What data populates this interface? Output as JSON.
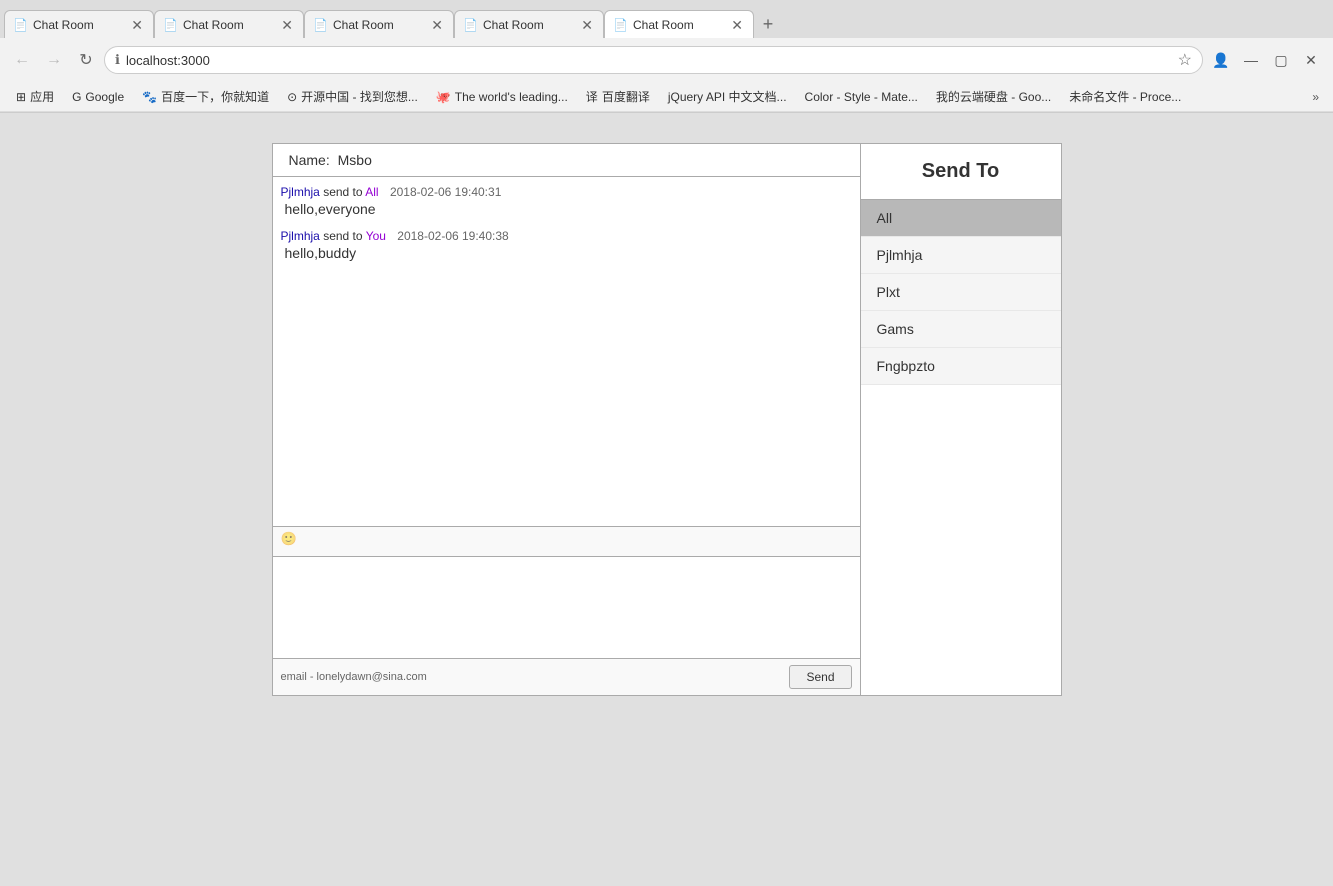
{
  "browser": {
    "tabs": [
      {
        "id": 1,
        "title": "Chat Room",
        "active": false
      },
      {
        "id": 2,
        "title": "Chat Room",
        "active": false
      },
      {
        "id": 3,
        "title": "Chat Room",
        "active": false
      },
      {
        "id": 4,
        "title": "Chat Room",
        "active": false
      },
      {
        "id": 5,
        "title": "Chat Room",
        "active": true
      }
    ],
    "url": "localhost:3000",
    "bookmarks": [
      {
        "label": "应用"
      },
      {
        "label": "Google"
      },
      {
        "label": "百度一下，你就知道"
      },
      {
        "label": "开源中国 - 找到您想..."
      },
      {
        "label": "The world's leading..."
      },
      {
        "label": "百度翻译"
      },
      {
        "label": "jQuery API 中文文档..."
      },
      {
        "label": "Color - Style - Mate..."
      },
      {
        "label": "我的云端硬盘 - Goo..."
      },
      {
        "label": "未命名文件 - Proce..."
      }
    ]
  },
  "chat": {
    "name_label": "Name:",
    "name_value": "Msbo",
    "messages": [
      {
        "sender": "Pjlmhja",
        "send_word": "send to",
        "recipient": "All",
        "timestamp": "2018-02-06 19:40:31",
        "body": "hello,everyone"
      },
      {
        "sender": "Pjlmhja",
        "send_word": "send to",
        "recipient": "You",
        "timestamp": "2018-02-06 19:40:38",
        "body": "hello,buddy"
      }
    ],
    "send_to_header": "Send To",
    "recipients": [
      {
        "id": "all",
        "label": "All",
        "selected": true
      },
      {
        "id": "pjlmhja",
        "label": "Pjlmhja",
        "selected": false
      },
      {
        "id": "plxt",
        "label": "Plxt",
        "selected": false
      },
      {
        "id": "gams",
        "label": "Gams",
        "selected": false
      },
      {
        "id": "fngbpzto",
        "label": "Fngbpzto",
        "selected": false
      }
    ],
    "send_button_label": "Send",
    "email_text": "email - lonelydawn@sina.com",
    "message_placeholder": ""
  }
}
